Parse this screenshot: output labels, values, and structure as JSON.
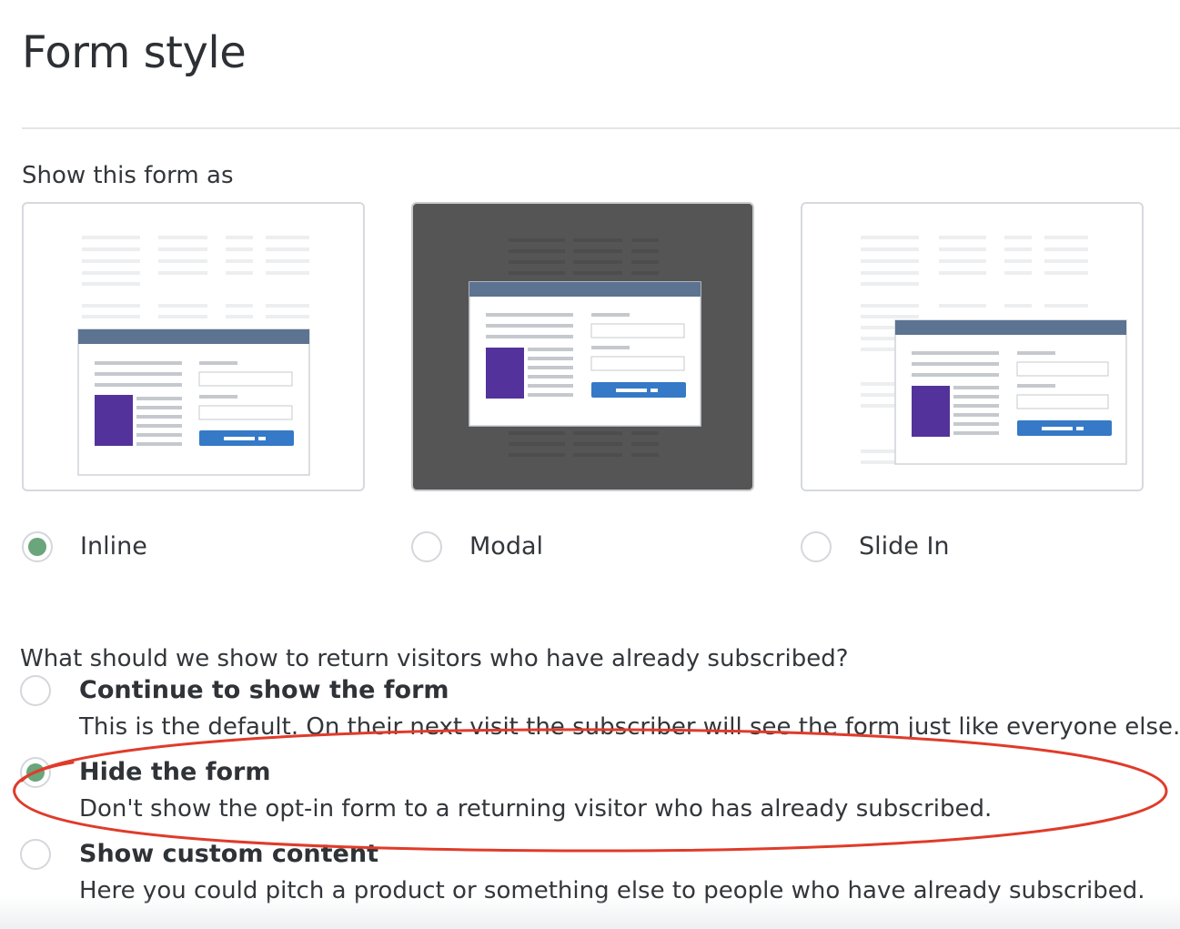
{
  "header": {
    "title": "Form style"
  },
  "display": {
    "label": "Show this form as",
    "options": [
      {
        "label": "Inline",
        "selected": true,
        "thumbnail": "inline-form-preview"
      },
      {
        "label": "Modal",
        "selected": false,
        "thumbnail": "modal-form-preview"
      },
      {
        "label": "Slide In",
        "selected": false,
        "thumbnail": "slide-in-form-preview"
      }
    ]
  },
  "returning": {
    "question": "What should we show to return visitors who have already subscribed?",
    "options": [
      {
        "title": "Continue to show the form",
        "description": "This is the default. On their next visit the subscriber will see the form just like everyone else.",
        "selected": false
      },
      {
        "title": "Hide the form",
        "description": "Don't show the opt-in form to a returning visitor who has already subscribed.",
        "selected": true
      },
      {
        "title": "Show custom content",
        "description": "Here you could pitch a product or something else to people who have already subscribed.",
        "selected": false
      }
    ]
  },
  "colors": {
    "selected_radio": "#6aa57c",
    "form_header_bar": "#5c7391",
    "image_block": "#53339b",
    "submit_button": "#3579c7",
    "modal_backdrop": "#555555",
    "annotation_ellipse": "#e03b2a"
  }
}
